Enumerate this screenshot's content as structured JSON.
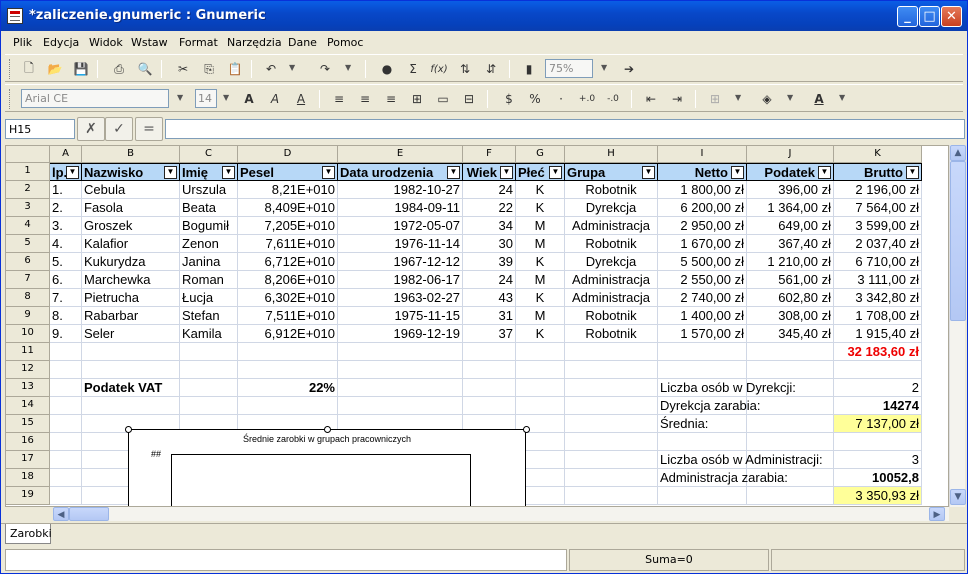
{
  "window": {
    "title": "*zaliczenie.gnumeric : Gnumeric"
  },
  "menu": [
    "Plik",
    "Edycja",
    "Widok",
    "Wstaw",
    "Format",
    "Narzędzia",
    "Dane",
    "Pomoc"
  ],
  "toolbar": {
    "font": "Arial CE",
    "size": "14",
    "zoom": "75%"
  },
  "formula": {
    "cellref": "H15",
    "content": ""
  },
  "columns": [
    "A",
    "B",
    "C",
    "D",
    "E",
    "F",
    "G",
    "H",
    "I",
    "J",
    "K"
  ],
  "rows": [
    "1",
    "2",
    "3",
    "4",
    "5",
    "6",
    "7",
    "8",
    "9",
    "10",
    "11",
    "12",
    "13",
    "14",
    "15",
    "16",
    "17",
    "18",
    "19"
  ],
  "headers": [
    "lp.",
    "Nazwisko",
    "Imię",
    "Pesel",
    "Data urodzenia",
    "Wiek",
    "Płeć",
    "Grupa",
    "Netto",
    "Podatek",
    "Brutto"
  ],
  "data": [
    [
      "1.",
      "Cebula",
      "Urszula",
      "8,21E+010",
      "1982-10-27",
      "24",
      "K",
      "Robotnik",
      "1 800,00 zł",
      "396,00 zł",
      "2 196,00 zł"
    ],
    [
      "2.",
      "Fasola",
      "Beata",
      "8,409E+010",
      "1984-09-11",
      "22",
      "K",
      "Dyrekcja",
      "6 200,00 zł",
      "1 364,00 zł",
      "7 564,00 zł"
    ],
    [
      "3.",
      "Groszek",
      "Bogumił",
      "7,205E+010",
      "1972-05-07",
      "34",
      "M",
      "Administracja",
      "2 950,00 zł",
      "649,00 zł",
      "3 599,00 zł"
    ],
    [
      "4.",
      "Kalafior",
      "Zenon",
      "7,611E+010",
      "1976-11-14",
      "30",
      "M",
      "Robotnik",
      "1 670,00 zł",
      "367,40 zł",
      "2 037,40 zł"
    ],
    [
      "5.",
      "Kukurydza",
      "Janina",
      "6,712E+010",
      "1967-12-12",
      "39",
      "K",
      "Dyrekcja",
      "5 500,00 zł",
      "1 210,00 zł",
      "6 710,00 zł"
    ],
    [
      "6.",
      "Marchewka",
      "Roman",
      "8,206E+010",
      "1982-06-17",
      "24",
      "M",
      "Administracja",
      "2 550,00 zł",
      "561,00 zł",
      "3 111,00 zł"
    ],
    [
      "7.",
      "Pietrucha",
      "Łucja",
      "6,302E+010",
      "1963-02-27",
      "43",
      "K",
      "Administracja",
      "2 740,00 zł",
      "602,80 zł",
      "3 342,80 zł"
    ],
    [
      "8.",
      "Rabarbar",
      "Stefan",
      "7,511E+010",
      "1975-11-15",
      "31",
      "M",
      "Robotnik",
      "1 400,00 zł",
      "308,00 zł",
      "1 708,00 zł"
    ],
    [
      "9.",
      "Seler",
      "Kamila",
      "6,912E+010",
      "1969-12-19",
      "37",
      "K",
      "Robotnik",
      "1 570,00 zł",
      "345,40 zł",
      "1 915,40 zł"
    ]
  ],
  "total_brutto": "32 183,60 zł",
  "vat": {
    "label": "Podatek VAT",
    "value": "22%"
  },
  "summary": {
    "dyr_count_label": "Liczba osób w Dyrekcji:",
    "dyr_count": "2",
    "dyr_sum_label": "Dyrekcja zarabia:",
    "dyr_sum": "14274",
    "avg_label": "Średnia:",
    "dyr_avg": "7 137,00 zł",
    "adm_count_label": "Liczba osób w Administracji:",
    "adm_count": "3",
    "adm_sum_label": "Administracja zarabia:",
    "adm_sum": "10052,8",
    "adm_avg": "3 350,93 zł"
  },
  "chart": {
    "title": "Średnie zarobki w grupach pracowniczych",
    "ytick": "##"
  },
  "sheet_tab": "Zarobki",
  "status": {
    "sum": "Suma=0"
  }
}
